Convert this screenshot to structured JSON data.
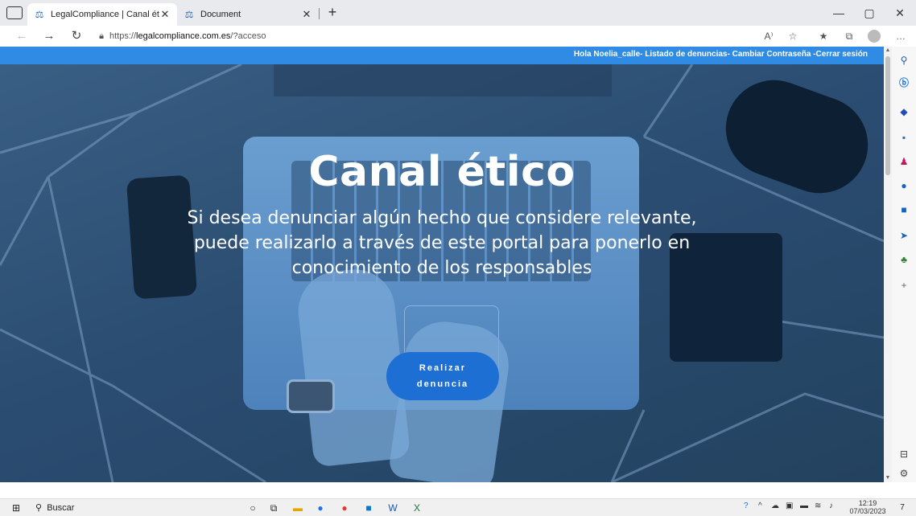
{
  "browser": {
    "tabs": [
      {
        "title": "LegalCompliance | Canal ético pa",
        "favicon": "scales-icon",
        "active": true
      },
      {
        "title": "Document",
        "favicon": "scales-icon",
        "active": false
      }
    ],
    "address": {
      "prefix": "https://",
      "host": "legalcompliance.com.es",
      "path": "/?acceso"
    },
    "read_aloud_label": "A⁾"
  },
  "page": {
    "user_bar": "Hola Noelia_calle- Listado de denuncias- Cambiar Contraseña -Cerrar sesión",
    "hero": {
      "title": "Canal ético",
      "subtitle": "Si desea denunciar algún hecho que considere relevante, puede realizarlo a través de este portal para ponerlo en conocimiento de los responsables",
      "cta_line1": "Realizar",
      "cta_line2": "denuncia"
    }
  },
  "taskbar": {
    "search_placeholder": "Buscar",
    "time": "12:19",
    "date": "07/03/2023",
    "notifications": "7"
  },
  "colors": {
    "topbar": "#2f8be3",
    "cta": "#1d6fd4",
    "hero_overlay": "#2b4d72"
  }
}
